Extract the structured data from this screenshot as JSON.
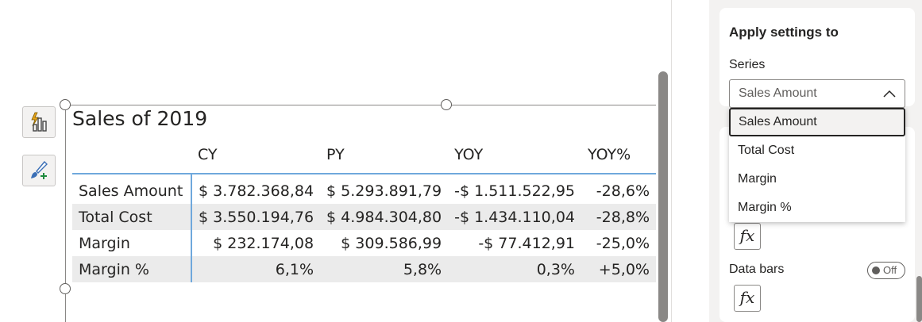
{
  "visual": {
    "title": "Sales of 2019",
    "columns": [
      "",
      "CY",
      "PY",
      "YOY",
      "YOY%"
    ],
    "rows": [
      {
        "label": "Sales Amount",
        "cy": "$ 3.782.368,84",
        "py": "$ 5.293.891,79",
        "yoy": "-$ 1.511.522,95",
        "yoy_pct": "-28,6%"
      },
      {
        "label": "Total Cost",
        "cy": "$ 3.550.194,76",
        "py": "$ 4.984.304,80",
        "yoy": "-$ 1.434.110,04",
        "yoy_pct": "-28,8%"
      },
      {
        "label": "Margin",
        "cy": "$ 232.174,08",
        "py": "$ 309.586,99",
        "yoy": "-$ 77.412,91",
        "yoy_pct": "-25,0%"
      },
      {
        "label": "Margin %",
        "cy": "6,1%",
        "py": "5,8%",
        "yoy": "0,3%",
        "yoy_pct": "+5,0%"
      }
    ]
  },
  "side_buttons": [
    {
      "icon": "format-visual-icon"
    },
    {
      "icon": "format-paintbrush-add-icon"
    }
  ],
  "pane": {
    "apply_title": "Apply settings to",
    "series_label": "Series",
    "series_value": "Sales Amount",
    "series_options": [
      "Sales Amount",
      "Total Cost",
      "Margin",
      "Margin %"
    ],
    "fx_label": "fx",
    "data_bars_label": "Data bars",
    "data_bars_toggle": "Off"
  },
  "colors": {
    "accent_line": "#6fa8dc",
    "band": "#ebebeb",
    "pane_bg": "#f3f2f1"
  }
}
